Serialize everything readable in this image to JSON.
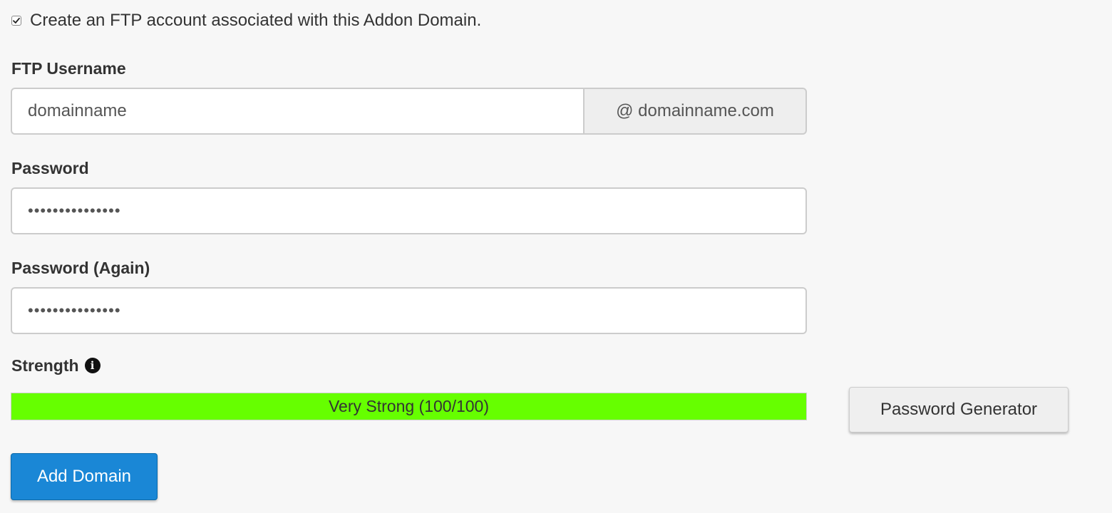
{
  "ftp_option": {
    "checked": true,
    "label": "Create an FTP account associated with this Addon Domain."
  },
  "ftp_username": {
    "label": "FTP Username",
    "value": "domainname",
    "suffix": "@ domainname.com"
  },
  "password": {
    "label": "Password",
    "masked_value": "•••••••••••••••"
  },
  "password_again": {
    "label": "Password (Again)",
    "masked_value": "•••••••••••••••"
  },
  "strength": {
    "label": "Strength",
    "info_icon": "info-circle-icon",
    "text": "Very Strong (100/100)",
    "score": 100,
    "max": 100,
    "color": "#66ff00"
  },
  "buttons": {
    "password_generator": "Password Generator",
    "add_domain": "Add Domain"
  },
  "colors": {
    "primary": "#1a87d6",
    "background": "#f7f7f7"
  }
}
